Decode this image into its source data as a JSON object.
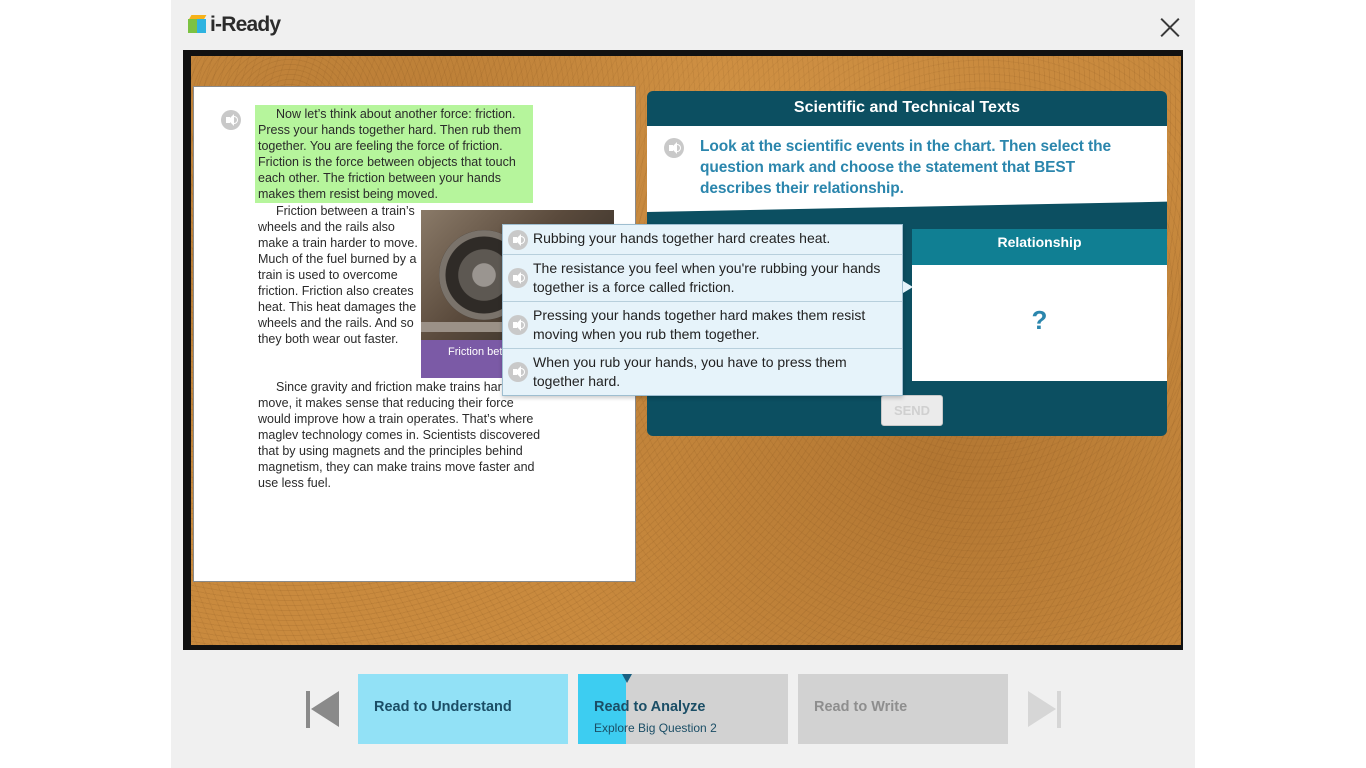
{
  "header": {
    "logo_text": "i-Ready",
    "close_icon": "close-icon"
  },
  "passage": {
    "paragraph1": "Now let’s think about another force: friction. Press your hands together hard. Then rub them together. You are feeling the force of friction. Friction is the force between objects that touch each other. The friction between your hands makes them resist being moved.",
    "paragraph2": "Friction between a train’s wheels and the rails also make a train harder to move. Much of the fuel burned by a train is used to overcome friction. Friction also creates heat. This heat damages the wheels and the rails. And so they both wear out faster.",
    "paragraph3": "Since gravity and friction make trains hard to move, it makes sense that reducing their force would improve how a train operates. That’s where maglev technology comes in. Scientists discovered that by using magnets and the principles behind magnetism, they can make trains move faster and use less fuel.",
    "photo_caption": "Friction betw and the rails",
    "highlight_color": "#b6f59c"
  },
  "question": {
    "title": "Scientific and Technical Texts",
    "prompt": "Look at the scientific events in the chart. Then select the question mark and choose the statement that BEST describes their relationship.",
    "relationship_header": "Relationship",
    "relationship_value": "?",
    "send_label": "SEND",
    "options": [
      "Rubbing your hands together hard creates heat.",
      "The resistance you feel when you're rubbing your hands together is a force called friction.",
      "Pressing your hands together hard makes them resist moving when you rub them together.",
      "When you rub your hands, you have to press them together hard."
    ]
  },
  "nav": {
    "steps": [
      {
        "label": "Read to Understand",
        "sub": ""
      },
      {
        "label": "Read to Analyze",
        "sub": "Explore Big Question 2",
        "progress": 0.23
      },
      {
        "label": "Read to Write",
        "sub": ""
      }
    ],
    "prev_icon": "skip-previous-icon",
    "next_icon": "skip-next-icon"
  },
  "colors": {
    "panel": "#0c4f61",
    "relationship_header": "#107f93",
    "prompt_text": "#2b86ad",
    "step_active": "#3dcdf1",
    "step_done": "#92e1f6"
  }
}
